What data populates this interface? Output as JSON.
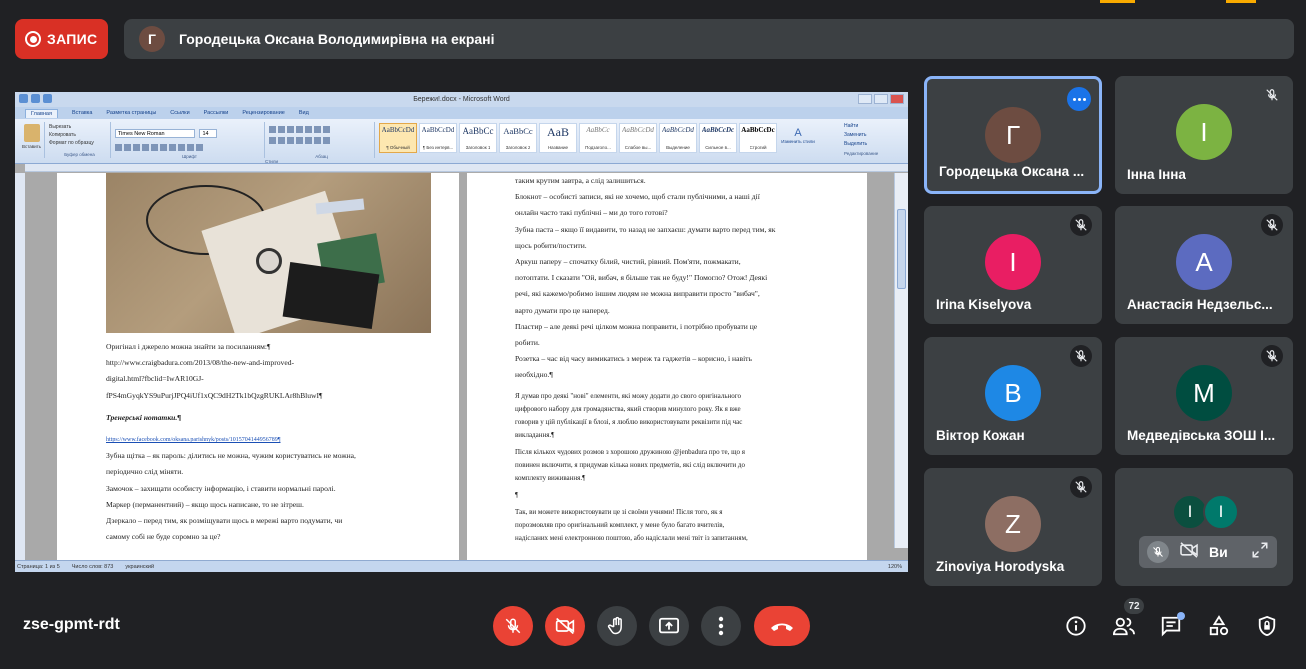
{
  "top": {
    "record_label": "ЗАПИС",
    "presenter_initial": "Г",
    "presenter_text": "Городецька Оксана Володимирівна на екрані"
  },
  "word": {
    "window_title": "Бережи!.docx - Microsoft Word",
    "tabs": [
      "Главная",
      "Вставка",
      "Разметка страницы",
      "Ссылки",
      "Рассылки",
      "Рецензирование",
      "Вид"
    ],
    "clipboard": {
      "paste": "Вставить",
      "cut": "Вырезать",
      "copy": "Копировать",
      "format": "Формат по образцу",
      "label": "Буфер обмена"
    },
    "font_name": "Times New Roman",
    "font_size": "14",
    "font_label": "Шрифт",
    "paragraph_label": "Абзац",
    "styles": [
      {
        "sample": "AaBbCcDd",
        "name": "¶ Обычный"
      },
      {
        "sample": "AaBbCcDd",
        "name": "¶ Без интерв..."
      },
      {
        "sample": "AaBbCc",
        "name": "Заголовок 1"
      },
      {
        "sample": "AaBbCc",
        "name": "Заголовок 2"
      },
      {
        "sample": "AaB",
        "name": "Название"
      },
      {
        "sample": "AaBbCc",
        "name": "Подзаголо..."
      },
      {
        "sample": "AaBbCcDd",
        "name": "Слабое вы..."
      },
      {
        "sample": "AaBbCcDd",
        "name": "Выделение"
      },
      {
        "sample": "AaBbCcDc",
        "name": "Сильное в..."
      },
      {
        "sample": "AaBbCcDc",
        "name": "Строгий"
      }
    ],
    "styles_label": "Стили",
    "change_styles": "Изменить стили",
    "editing": {
      "find": "Найти",
      "replace": "Заменить",
      "select": "Выделить",
      "label": "Редактирование"
    },
    "left_page": [
      "Оригінал і джерело можна знайти за посиланням:¶",
      "http://www.craigbadura.com/2013/08/the-new-and-improved-",
      "digital.html?fbclid=IwAR10GJ-",
      "fPS4mGyqkYS9uPurjJPQ4iUf1xQC9dH2Tk1bQzgRUKLAr8hBluwI¶",
      "Тренерські нотатки.¶",
      "https://www.facebook.com/oksana.parishnyk/posts/1015704144956789¶",
      "Зубна щітка – як пароль: ділитись не можна, чужим користуватись не можна,",
      "періодично слід міняти.",
      "Замочок – захищати особисту інформацію, і ставити нормальні паролі.",
      "Маркер (перманентний) – якщо щось написане, то не зітреш.",
      "Дзеркало – перед тим, як розміщувати щось в мережі варто подумати, чи",
      "самому собі не буде соромно за це?"
    ],
    "right_page": [
      "таким крутим завтра, а слід залишиться.",
      "Блокнот – особисті записи, які не хочемо, щоб стали публічними, а наші дії",
      "онлайн часто такі публічні – ми до того готові?",
      "Зубна паста – якщо її видавити, то назад не запхаєш: думати варто перед тим, як",
      "щось робити/постити.",
      "Аркуш паперу – спочатку білий, чистий, рівний. Пом'яти, пожмакати,",
      "потоптати. І сказати \"Ой, вибач, я більше так не буду!\" Помогло? Отож! Деякі",
      "речі, які кажемо/робимо іншим людям не можна виправити просто \"вибач\",",
      "варто думати про це наперед.",
      "Пластир – але деякі речі цілком можна поправити, і потрібно пробувати це",
      "робити.",
      "Розетка – час від часу вимикатись з мереж та гаджетів – корисно, і навіть",
      "необхідно.¶",
      "Я думав про деякі \"нові\" елементи, які можу додати до свого оригінального",
      "цифрового набору для громадянства, який створив минулого року. Як я вже",
      "говорив у цій публікації в блозі, я люблю використовувати реквізити під час",
      "викладання.¶",
      "Після кількох чудових розмов з хорошою дружиною @jenbadura про те, що я",
      "повинен включити, я придумав кілька нових предметів, які слід включити до",
      "комплекту виживання.¶",
      "¶",
      "Так, ви можете використовувати це зі своїми учнями! Після того, як я",
      "порозмовляв про оригінальний комплект, у мене було багато вчителів,",
      "надісланих мені електронною поштою, або надіслали мені твіт із запитанням,"
    ],
    "status": {
      "page": "Страница: 1 из 5",
      "words": "Число слов: 873",
      "lang": "украинский",
      "zoom": "120%"
    }
  },
  "participants": [
    {
      "initial": "Г",
      "name": "Городецька Оксана ...",
      "color": "#6d4c41",
      "active": true
    },
    {
      "initial": "І",
      "name": "Інна Інна",
      "color": "#7cb342",
      "active": false
    },
    {
      "initial": "I",
      "name": "Irina Kiselyova",
      "color": "#e91e63",
      "active": false
    },
    {
      "initial": "А",
      "name": "Анастасія Недзельс...",
      "color": "#5c6bc0",
      "active": false
    },
    {
      "initial": "В",
      "name": "Віктор Кожан",
      "color": "#1e88e5",
      "active": false
    },
    {
      "initial": "М",
      "name": "Медведівська ЗОШ І...",
      "color": "#004d40",
      "active": false
    },
    {
      "initial": "Z",
      "name": "Zinoviya Horodyska",
      "color": "#8d6e63",
      "active": false
    }
  ],
  "others_tile": {
    "initials": [
      "I",
      "I"
    ],
    "label": "Ви"
  },
  "bottom": {
    "meeting_code": "zse-gpmt-rdt",
    "participant_count": "72"
  }
}
